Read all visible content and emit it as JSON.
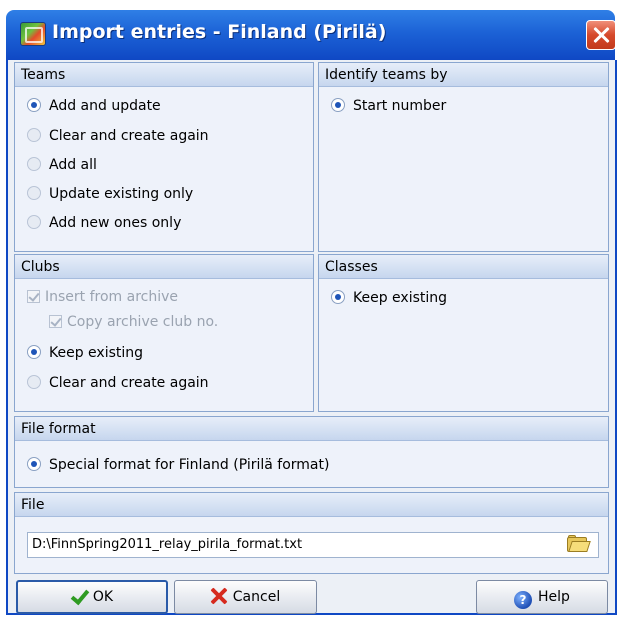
{
  "window": {
    "title": "Import entries - Finland (Pirilä)"
  },
  "teams": {
    "header": "Teams",
    "options": [
      {
        "label": "Add and update",
        "selected": true
      },
      {
        "label": "Clear and create again",
        "selected": false
      },
      {
        "label": "Add all",
        "selected": false
      },
      {
        "label": "Update existing only",
        "selected": false
      },
      {
        "label": "Add new ones only",
        "selected": false
      }
    ]
  },
  "identify": {
    "header": "Identify teams by",
    "options": [
      {
        "label": "Start number",
        "selected": true
      }
    ]
  },
  "clubs": {
    "header": "Clubs",
    "insert_from_archive": {
      "label": "Insert from archive",
      "checked": true,
      "enabled": false
    },
    "copy_archive_club_no": {
      "label": "Copy archive club no.",
      "checked": true,
      "enabled": false
    },
    "options": [
      {
        "label": "Keep existing",
        "selected": true
      },
      {
        "label": "Clear and create again",
        "selected": false
      }
    ]
  },
  "classes": {
    "header": "Classes",
    "options": [
      {
        "label": "Keep existing",
        "selected": true
      }
    ]
  },
  "file_format": {
    "header": "File format",
    "options": [
      {
        "label": "Special format for Finland (Pirilä format)",
        "selected": true
      }
    ]
  },
  "file": {
    "header": "File",
    "path": "D:\\FinnSpring2011_relay_pirila_format.txt"
  },
  "buttons": {
    "ok": "OK",
    "cancel": "Cancel",
    "help": "Help"
  },
  "icons": {
    "app": "app-icon",
    "close": "close-icon",
    "folder": "folder-open-icon",
    "ok": "checkmark-icon",
    "cancel": "x-icon",
    "help": "help-icon"
  },
  "colors": {
    "titlebar": "#1c62d6",
    "panel_header": "#c6d6ee",
    "body": "#ecf0f6",
    "close": "#d64a2c"
  }
}
